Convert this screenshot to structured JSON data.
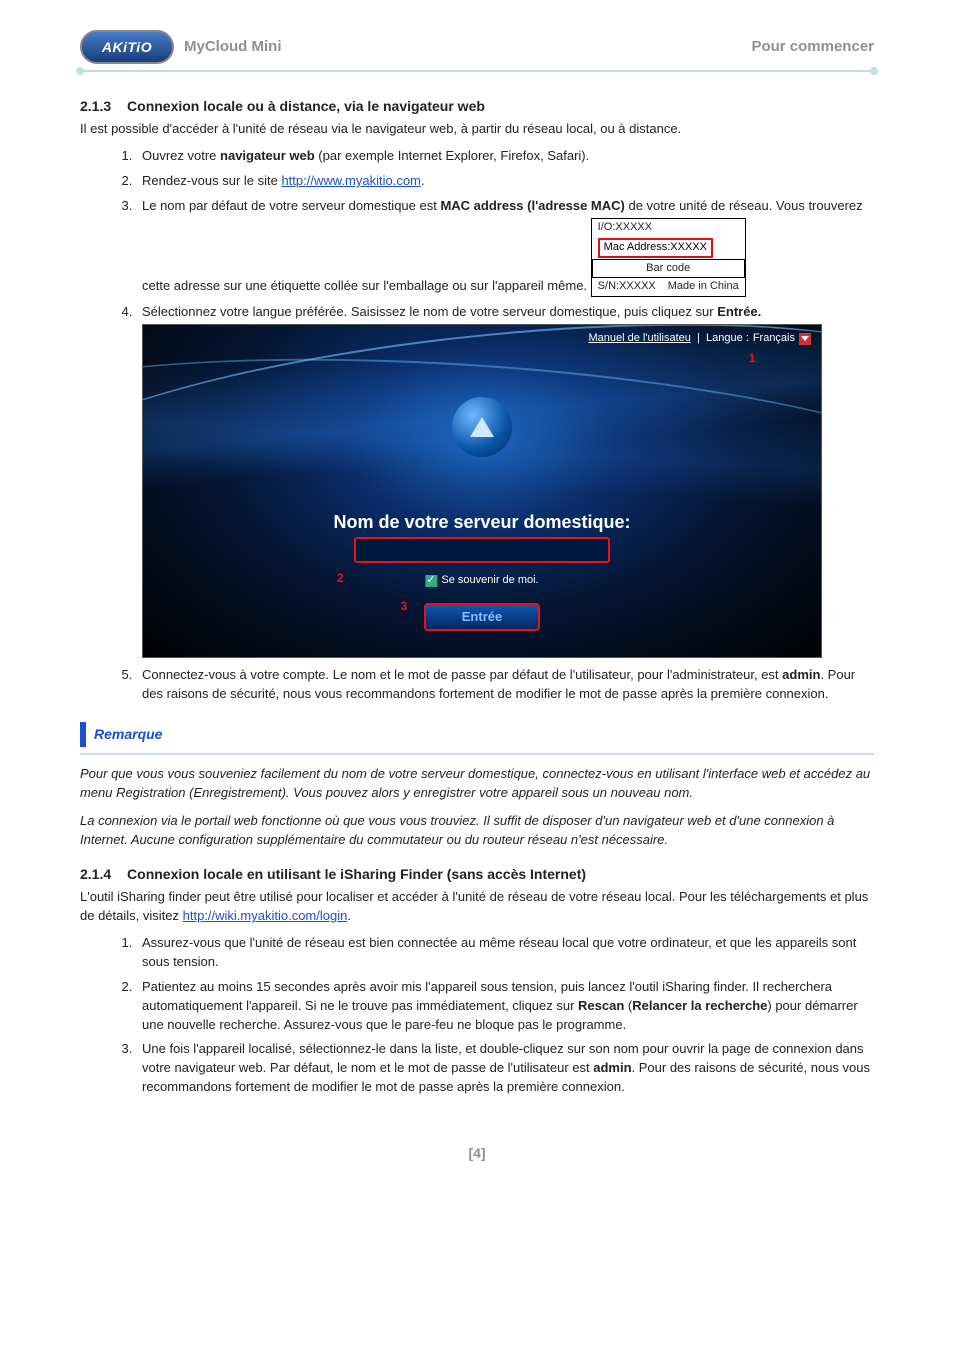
{
  "header": {
    "logo_text": "AKiTiO",
    "title_left": "MyCloud Mini",
    "title_right": "Pour commencer"
  },
  "section213": {
    "number": "2.1.3",
    "title": "Connexion locale ou à distance, via le navigateur web",
    "intro": "Il est possible d'accéder à l'unité de réseau via le navigateur web, à partir du réseau local, ou à distance.",
    "steps": {
      "s1_a": "Ouvrez votre ",
      "s1_b": "navigateur web",
      "s1_c": " (par exemple Internet Explorer, Firefox, Safari).",
      "s2_a": "Rendez-vous sur le site ",
      "s2_link": "http://www.myakitio.com",
      "s2_b": ".",
      "s3_a": "Le nom par défaut de votre serveur domestique est ",
      "s3_b": "MAC address (l'adresse MAC)",
      "s3_c": " de votre unité de réseau. Vous trouverez cette adresse sur une étiquette collée sur l'emballage ou sur l'appareil même.",
      "s4_a": "Sélectionnez votre langue préférée. Saisissez le nom de votre serveur domestique, puis cliquez sur ",
      "s4_b": "Entrée.",
      "s5_a": "Connectez-vous à votre compte. Le nom et le mot de passe par défaut de l'utilisateur, pour l'administrateur, est ",
      "s5_b": "admin",
      "s5_c": ". Pour des raisons de sécurité, nous vous recommandons fortement de modifier le mot de passe après la première connexion."
    },
    "label": {
      "io": "I/O:XXXXX",
      "mac": "Mac Address:XXXXX",
      "barcode": "Bar code",
      "sn": "S/N:XXXXX",
      "made": "Made in China"
    },
    "login": {
      "manual": "Manuel de l'utilisateu",
      "lang_label": "Langue :",
      "lang_value": "Français",
      "title": "Nom de votre serveur domestique:",
      "remember": "Se souvenir de moi.",
      "enter": "Entrée",
      "m1": "1",
      "m2": "2",
      "m3": "3"
    }
  },
  "remark": {
    "label": "Remarque",
    "p1": "Pour que vous vous souveniez facilement du nom de votre serveur domestique, connectez-vous en utilisant l'interface web et accédez au menu Registration (Enregistrement). Vous pouvez alors y enregistrer votre appareil sous un nouveau nom.",
    "p2": "La connexion via le portail web fonctionne où que vous vous trouviez. Il suffit de disposer d'un navigateur web et d'une connexion à Internet. Aucune configuration supplémentaire du commutateur ou du routeur réseau n'est nécessaire."
  },
  "section214": {
    "number": "2.1.4",
    "title": "Connexion locale en utilisant le iSharing Finder (sans accès Internet)",
    "intro_a": "L'outil iSharing finder peut être utilisé pour localiser et accéder à l'unité de réseau de votre réseau local. Pour les téléchargements et plus de détails, visitez ",
    "intro_link": "http://wiki.myakitio.com/login",
    "intro_b": ".",
    "steps": {
      "s1": "Assurez-vous que l'unité de réseau est bien connectée au même réseau local que votre ordinateur, et que les appareils sont sous tension.",
      "s2_a": "Patientez au moins 15 secondes après avoir mis l'appareil sous tension, puis lancez l'outil iSharing finder. Il recherchera automatiquement l'appareil. Si ne le trouve pas immédiatement, cliquez sur ",
      "s2_b": "Rescan",
      "s2_c": " (",
      "s2_d": "Relancer la recherche",
      "s2_e": ") pour démarrer une nouvelle recherche. Assurez-vous que le pare-feu ne bloque pas le programme.",
      "s3_a": "Une fois l'appareil localisé, sélectionnez-le dans la liste, et double-cliquez sur son nom pour ouvrir la page de connexion dans votre navigateur web. Par défaut, le nom et le mot de passe de l'utilisateur est ",
      "s3_b": "admin",
      "s3_c": ". Pour des raisons de sécurité, nous vous recommandons fortement de modifier le mot de passe après la première connexion."
    }
  },
  "page_number": "[4]"
}
